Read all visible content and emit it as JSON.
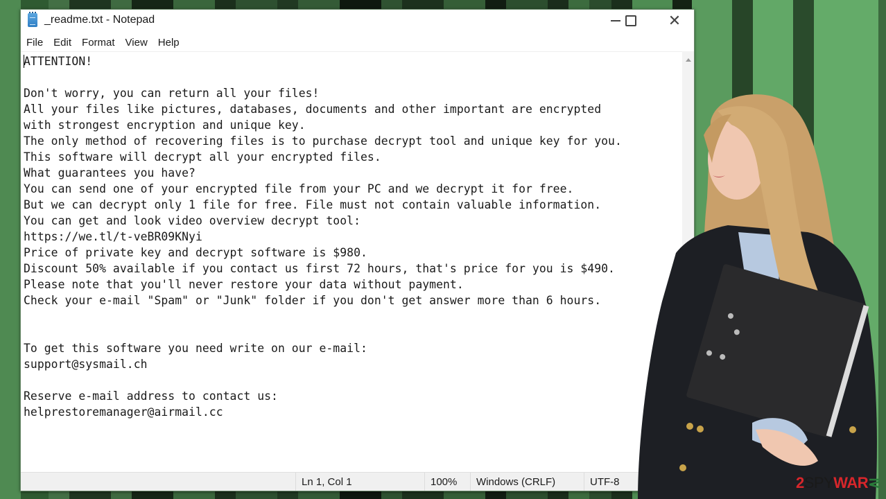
{
  "window": {
    "title": "_readme.txt - Notepad",
    "controls": {
      "minimize": "minimize",
      "maximize": "maximize",
      "close": "close"
    }
  },
  "menu": [
    "File",
    "Edit",
    "Format",
    "View",
    "Help"
  ],
  "document": {
    "lines": [
      "ATTENTION!",
      "",
      "Don't worry, you can return all your files!",
      "All your files like pictures, databases, documents and other important are encrypted",
      "with strongest encryption and unique key.",
      "The only method of recovering files is to purchase decrypt tool and unique key for you.",
      "This software will decrypt all your encrypted files.",
      "What guarantees you have?",
      "You can send one of your encrypted file from your PC and we decrypt it for free.",
      "But we can decrypt only 1 file for free. File must not contain valuable information.",
      "You can get and look video overview decrypt tool:",
      "https://we.tl/t-veBR09KNyi",
      "Price of private key and decrypt software is $980.",
      "Discount 50% available if you contact us first 72 hours, that's price for you is $490.",
      "Please note that you'll never restore your data without payment.",
      "Check your e-mail \"Spam\" or \"Junk\" folder if you don't get answer more than 6 hours.",
      "",
      "",
      "To get this software you need write on our e-mail:",
      "support@sysmail.ch",
      "",
      "Reserve e-mail address to contact us:",
      "helprestoremanager@airmail.cc"
    ]
  },
  "statusbar": {
    "position": "Ln 1, Col 1",
    "zoom": "100%",
    "line_ending": "Windows (CRLF)",
    "encoding": "UTF-8"
  },
  "watermark": {
    "part1": "2",
    "part2": "SPY",
    "part3": "WAR",
    "part4": "⋜"
  },
  "colors": {
    "bg_dark": "#1c2e1d",
    "bg_mid": "#3d6b3f",
    "bg_light": "#5fa566",
    "logo_red": "#d7262b"
  }
}
